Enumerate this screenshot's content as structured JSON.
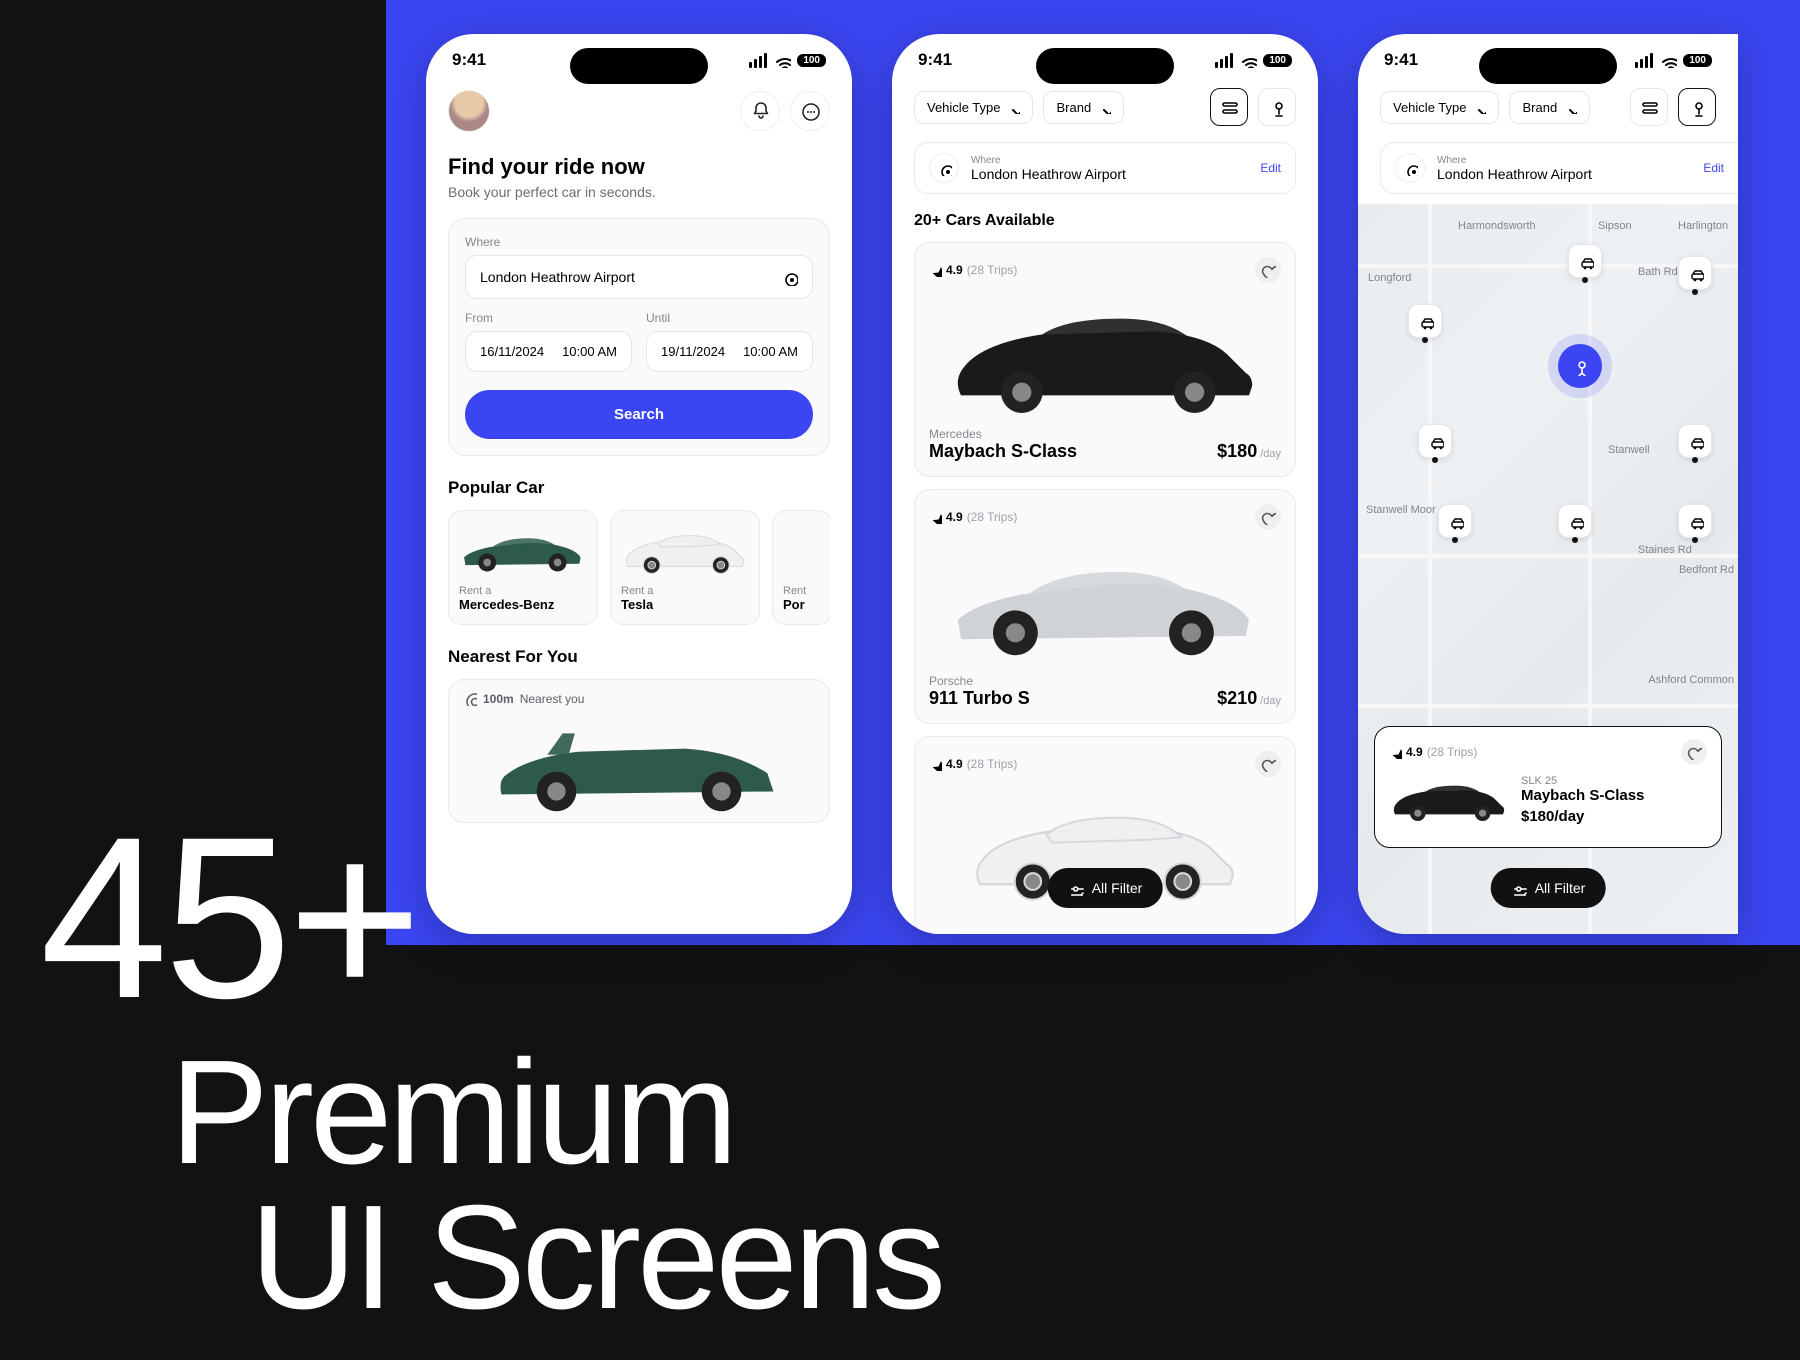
{
  "marketing": {
    "count": "45+",
    "line2": "Premium",
    "line3": "UI Screens"
  },
  "statusbar": {
    "time": "9:41",
    "battery": "100"
  },
  "screen1": {
    "title": "Find your ride now",
    "subtitle": "Book your perfect car in seconds.",
    "form": {
      "where_label": "Where",
      "where_value": "London Heathrow Airport",
      "from_label": "From",
      "from_date": "16/11/2024",
      "from_time": "10:00 AM",
      "until_label": "Until",
      "until_date": "19/11/2024",
      "until_time": "10:00 AM",
      "search_label": "Search"
    },
    "popular_heading": "Popular Car",
    "popular": [
      {
        "prefix": "Rent a",
        "name": "Mercedes-Benz"
      },
      {
        "prefix": "Rent a",
        "name": "Tesla"
      },
      {
        "prefix": "Rent",
        "name": "Por"
      }
    ],
    "nearest_heading": "Nearest For You",
    "nearest_card": {
      "distance": "100m",
      "suffix": "Nearest you"
    }
  },
  "screen2": {
    "filters": {
      "vehicle_type": "Vehicle Type",
      "brand": "Brand"
    },
    "where_label": "Where",
    "where_value": "London Heathrow Airport",
    "edit_label": "Edit",
    "available_heading": "20+ Cars Available",
    "listings": [
      {
        "rating": "4.9",
        "trips": "(28 Trips)",
        "brand": "Mercedes",
        "model": "Maybach S-Class",
        "price": "$180",
        "per": "/day",
        "car": "dark"
      },
      {
        "rating": "4.9",
        "trips": "(28 Trips)",
        "brand": "Porsche",
        "model": "911 Turbo S",
        "price": "$210",
        "per": "/day",
        "car": "silver"
      },
      {
        "rating": "4.9",
        "trips": "(28 Trips)",
        "brand": "",
        "model": "",
        "price": "",
        "per": "",
        "car": "white"
      }
    ],
    "all_filter": "All Filter"
  },
  "screen3": {
    "filters": {
      "vehicle_type": "Vehicle Type",
      "brand": "Brand"
    },
    "where_label": "Where",
    "where_value": "London Heathrow Airport",
    "edit_label": "Edit",
    "map_places": [
      "Harmondsworth",
      "Sipson",
      "Harlington",
      "Longford",
      "Stanwell",
      "Stanwell Moor",
      "Staines Rd",
      "Bedfont Rd",
      "Bath Rd",
      "Ashford Common"
    ],
    "card": {
      "rating": "4.9",
      "trips": "(28 Trips)",
      "code": "SLK 25",
      "model": "Maybach S-Class",
      "price": "$180",
      "per": "/day"
    },
    "all_filter": "All Filter"
  }
}
